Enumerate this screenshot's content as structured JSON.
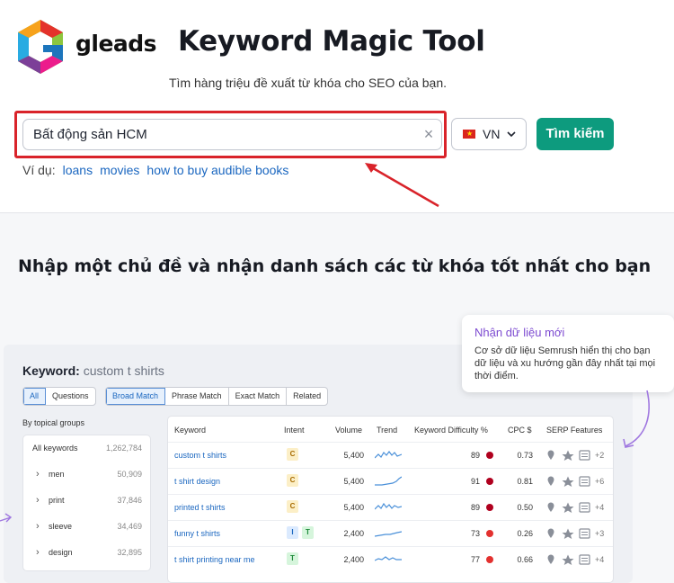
{
  "brand": {
    "name": "gleads"
  },
  "header": {
    "title": "Keyword Magic Tool",
    "subtitle": "Tìm hàng triệu đề xuất từ khóa cho SEO của bạn."
  },
  "search": {
    "value": "Bất động sản HCM",
    "clear_symbol": "×",
    "country": "VN",
    "button_label": "Tìm kiếm",
    "examples_label": "Ví dụ:",
    "examples": [
      "loans",
      "movies",
      "how to buy audible books"
    ]
  },
  "section": {
    "title": "Nhập một chủ đề và nhận danh sách các từ khóa tốt nhất cho bạn"
  },
  "tooltip": {
    "title": "Nhận dữ liệu mới",
    "body": "Cơ sở dữ liệu Semrush hiển thị cho bạn dữ liệu và xu hướng gần đây nhất tại mọi thời điểm."
  },
  "preview": {
    "keyword_label": "Keyword:",
    "keyword_value": "custom t shirts",
    "filter_all": [
      "All",
      "Questions"
    ],
    "filter_match": [
      "Broad Match",
      "Phrase Match",
      "Exact Match",
      "Related"
    ],
    "groups_title": "By topical groups",
    "groups": [
      {
        "name": "All keywords",
        "count": "1,262,784",
        "chevron": false
      },
      {
        "name": "men",
        "count": "50,909",
        "chevron": true
      },
      {
        "name": "print",
        "count": "37,846",
        "chevron": true
      },
      {
        "name": "sleeve",
        "count": "34,469",
        "chevron": true
      },
      {
        "name": "design",
        "count": "32,895",
        "chevron": true
      }
    ],
    "columns": [
      "Keyword",
      "Intent",
      "Volume",
      "Trend",
      "Keyword Difficulty %",
      "CPC $",
      "SERP Features"
    ],
    "rows": [
      {
        "keyword": "custom t shirts",
        "intent": [
          "C"
        ],
        "volume": "5,400",
        "kd": "89",
        "kd_color": "#b0001e",
        "cpc": "0.73",
        "serp_more": "+2"
      },
      {
        "keyword": "t shirt design",
        "intent": [
          "C"
        ],
        "volume": "5,400",
        "kd": "91",
        "kd_color": "#b0001e",
        "cpc": "0.81",
        "serp_more": "+6"
      },
      {
        "keyword": "printed t shirts",
        "intent": [
          "C"
        ],
        "volume": "5,400",
        "kd": "89",
        "kd_color": "#b0001e",
        "cpc": "0.50",
        "serp_more": "+4"
      },
      {
        "keyword": "funny t shirts",
        "intent": [
          "I",
          "T"
        ],
        "volume": "2,400",
        "kd": "73",
        "kd_color": "#e3312f",
        "cpc": "0.26",
        "serp_more": "+3"
      },
      {
        "keyword": "t shirt printing near me",
        "intent": [
          "T"
        ],
        "volume": "2,400",
        "kd": "77",
        "kd_color": "#e3312f",
        "cpc": "0.66",
        "serp_more": "+4"
      }
    ],
    "intent_colors": {
      "C": "#fcefc7",
      "I": "#dbeafe",
      "T": "#d6f5dc"
    },
    "intent_text_colors": {
      "C": "#a86b00",
      "I": "#1b67c0",
      "T": "#1f8a3b"
    }
  },
  "colors": {
    "accent": "#0d9b7e",
    "link": "#1b67c0",
    "highlight_box": "#d9232a",
    "tooltip_title": "#7d4bd1"
  }
}
